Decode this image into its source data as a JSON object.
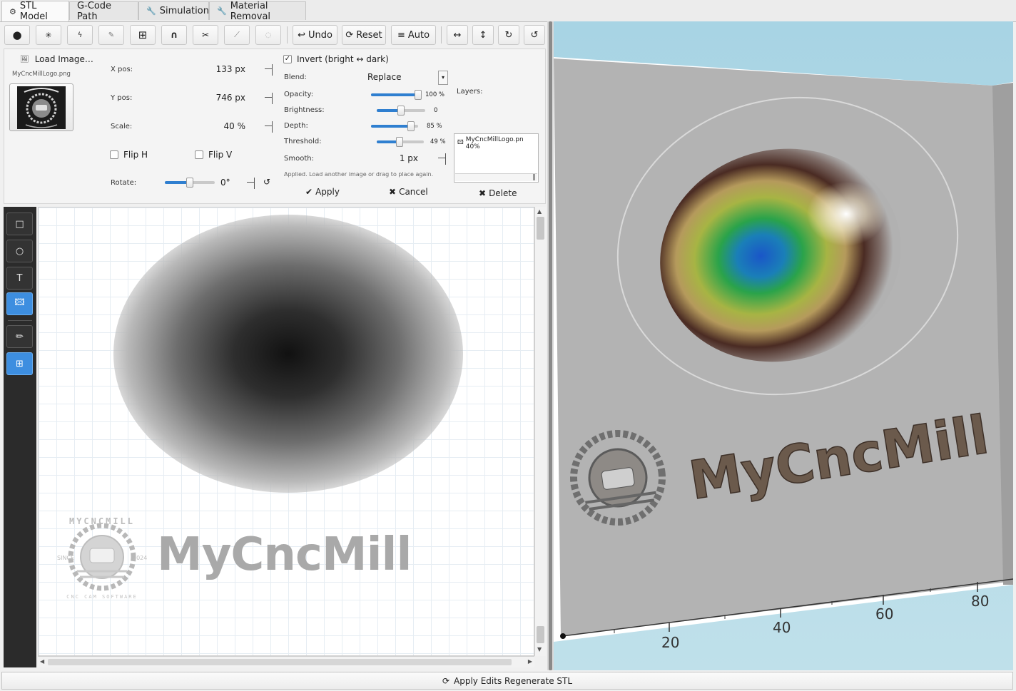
{
  "tabs": [
    {
      "label": "STL Model",
      "icon": "cube-icon",
      "active": true
    },
    {
      "label": "G-Code Path",
      "icon": "",
      "active": false
    },
    {
      "label": "Simulation",
      "icon": "wrench-icon",
      "active": false
    },
    {
      "label": "Material Removal",
      "icon": "wrench-icon",
      "active": false
    }
  ],
  "toolbar": {
    "icon_buttons": [
      "circle-brush-icon",
      "star-brush-icon",
      "lightning-icon",
      "eyedropper-icon",
      "grid-icon",
      "arch-icon",
      "scissors-icon",
      "line-chart-icon",
      "bulb-icon"
    ],
    "undo_label": "Undo",
    "reset_label": "Reset",
    "auto_label": "Auto",
    "flip_h_icon": "arrow-horizontal-icon",
    "flip_v_icon": "arrow-vertical-icon",
    "rotate_cw_icon": "rotate-cw-icon",
    "rotate_ccw_icon": "rotate-ccw-icon"
  },
  "image_panel": {
    "load_label": "Load Image…",
    "file_name": "MyCncMillLogo.png",
    "x_pos_label": "X pos:",
    "x_pos_value": "133 px",
    "y_pos_label": "Y pos:",
    "y_pos_value": "746 px",
    "scale_label": "Scale:",
    "scale_value": "40 %",
    "flip_h_label": "Flip H",
    "flip_v_label": "Flip V",
    "rotate_label": "Rotate:",
    "rotate_value": "0°",
    "rotate_fraction": 0.5
  },
  "blend_panel": {
    "invert_label": "Invert (bright ↔ dark)",
    "invert_checked": true,
    "blend_label": "Blend:",
    "blend_value": "Replace",
    "opacity_label": "Opacity:",
    "opacity_value": "100 %",
    "opacity_fraction": 1.0,
    "brightness_label": "Brightness:",
    "brightness_value": "0",
    "brightness_fraction": 0.5,
    "depth_label": "Depth:",
    "depth_value": "85 %",
    "depth_fraction": 0.85,
    "threshold_label": "Threshold:",
    "threshold_value": "49 %",
    "threshold_fraction": 0.49,
    "smooth_label": "Smooth:",
    "smooth_value": "1 px",
    "status_text": "Applied. Load another image or drag to place again.",
    "apply_label": "Apply",
    "cancel_label": "Cancel"
  },
  "layers_panel": {
    "title": "Layers:",
    "items": [
      "MyCncMillLogo.pn 40%"
    ],
    "delete_label": "Delete"
  },
  "canvas": {
    "logo_text": "MyCncMill",
    "badge_top": "MYCNCMILL",
    "badge_since": "SINCE",
    "badge_year": "2024",
    "badge_bottom": "CNC CAM SOFTWARE"
  },
  "sidebar_tools": [
    {
      "icon": "rectangle-icon",
      "label": "□",
      "active": false
    },
    {
      "icon": "ellipse-icon",
      "label": "○",
      "active": false
    },
    {
      "icon": "text-icon",
      "label": "T",
      "active": false
    },
    {
      "icon": "image-icon",
      "label": "🖾",
      "active": true
    },
    {
      "icon": "pencil-icon",
      "label": "✏",
      "active": false
    },
    {
      "icon": "grid-icon",
      "label": "⊞",
      "active": true
    }
  ],
  "view3d": {
    "axis_labels": [
      "20",
      "40",
      "60",
      "80"
    ],
    "logo_text": "MyCncMill"
  },
  "bottom": {
    "regenerate_label": "Apply Edits  Regenerate STL"
  },
  "colors": {
    "accent": "#3d8ee0",
    "sky": "#a8d4e4",
    "stock": "#b3b3b3"
  }
}
